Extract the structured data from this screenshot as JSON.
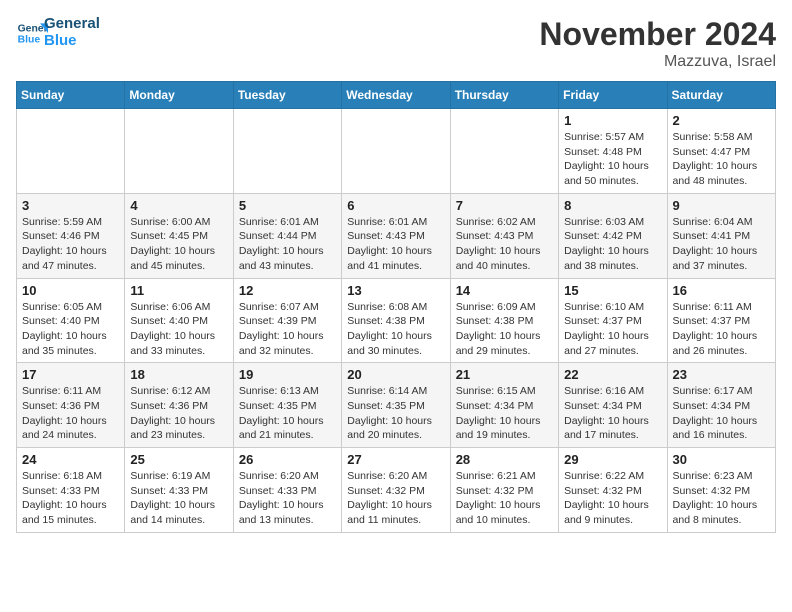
{
  "logo": {
    "line1": "General",
    "line2": "Blue"
  },
  "title": "November 2024",
  "location": "Mazzuva, Israel",
  "weekdays": [
    "Sunday",
    "Monday",
    "Tuesday",
    "Wednesday",
    "Thursday",
    "Friday",
    "Saturday"
  ],
  "weeks": [
    [
      {
        "day": "",
        "info": ""
      },
      {
        "day": "",
        "info": ""
      },
      {
        "day": "",
        "info": ""
      },
      {
        "day": "",
        "info": ""
      },
      {
        "day": "",
        "info": ""
      },
      {
        "day": "1",
        "info": "Sunrise: 5:57 AM\nSunset: 4:48 PM\nDaylight: 10 hours\nand 50 minutes."
      },
      {
        "day": "2",
        "info": "Sunrise: 5:58 AM\nSunset: 4:47 PM\nDaylight: 10 hours\nand 48 minutes."
      }
    ],
    [
      {
        "day": "3",
        "info": "Sunrise: 5:59 AM\nSunset: 4:46 PM\nDaylight: 10 hours\nand 47 minutes."
      },
      {
        "day": "4",
        "info": "Sunrise: 6:00 AM\nSunset: 4:45 PM\nDaylight: 10 hours\nand 45 minutes."
      },
      {
        "day": "5",
        "info": "Sunrise: 6:01 AM\nSunset: 4:44 PM\nDaylight: 10 hours\nand 43 minutes."
      },
      {
        "day": "6",
        "info": "Sunrise: 6:01 AM\nSunset: 4:43 PM\nDaylight: 10 hours\nand 41 minutes."
      },
      {
        "day": "7",
        "info": "Sunrise: 6:02 AM\nSunset: 4:43 PM\nDaylight: 10 hours\nand 40 minutes."
      },
      {
        "day": "8",
        "info": "Sunrise: 6:03 AM\nSunset: 4:42 PM\nDaylight: 10 hours\nand 38 minutes."
      },
      {
        "day": "9",
        "info": "Sunrise: 6:04 AM\nSunset: 4:41 PM\nDaylight: 10 hours\nand 37 minutes."
      }
    ],
    [
      {
        "day": "10",
        "info": "Sunrise: 6:05 AM\nSunset: 4:40 PM\nDaylight: 10 hours\nand 35 minutes."
      },
      {
        "day": "11",
        "info": "Sunrise: 6:06 AM\nSunset: 4:40 PM\nDaylight: 10 hours\nand 33 minutes."
      },
      {
        "day": "12",
        "info": "Sunrise: 6:07 AM\nSunset: 4:39 PM\nDaylight: 10 hours\nand 32 minutes."
      },
      {
        "day": "13",
        "info": "Sunrise: 6:08 AM\nSunset: 4:38 PM\nDaylight: 10 hours\nand 30 minutes."
      },
      {
        "day": "14",
        "info": "Sunrise: 6:09 AM\nSunset: 4:38 PM\nDaylight: 10 hours\nand 29 minutes."
      },
      {
        "day": "15",
        "info": "Sunrise: 6:10 AM\nSunset: 4:37 PM\nDaylight: 10 hours\nand 27 minutes."
      },
      {
        "day": "16",
        "info": "Sunrise: 6:11 AM\nSunset: 4:37 PM\nDaylight: 10 hours\nand 26 minutes."
      }
    ],
    [
      {
        "day": "17",
        "info": "Sunrise: 6:11 AM\nSunset: 4:36 PM\nDaylight: 10 hours\nand 24 minutes."
      },
      {
        "day": "18",
        "info": "Sunrise: 6:12 AM\nSunset: 4:36 PM\nDaylight: 10 hours\nand 23 minutes."
      },
      {
        "day": "19",
        "info": "Sunrise: 6:13 AM\nSunset: 4:35 PM\nDaylight: 10 hours\nand 21 minutes."
      },
      {
        "day": "20",
        "info": "Sunrise: 6:14 AM\nSunset: 4:35 PM\nDaylight: 10 hours\nand 20 minutes."
      },
      {
        "day": "21",
        "info": "Sunrise: 6:15 AM\nSunset: 4:34 PM\nDaylight: 10 hours\nand 19 minutes."
      },
      {
        "day": "22",
        "info": "Sunrise: 6:16 AM\nSunset: 4:34 PM\nDaylight: 10 hours\nand 17 minutes."
      },
      {
        "day": "23",
        "info": "Sunrise: 6:17 AM\nSunset: 4:34 PM\nDaylight: 10 hours\nand 16 minutes."
      }
    ],
    [
      {
        "day": "24",
        "info": "Sunrise: 6:18 AM\nSunset: 4:33 PM\nDaylight: 10 hours\nand 15 minutes."
      },
      {
        "day": "25",
        "info": "Sunrise: 6:19 AM\nSunset: 4:33 PM\nDaylight: 10 hours\nand 14 minutes."
      },
      {
        "day": "26",
        "info": "Sunrise: 6:20 AM\nSunset: 4:33 PM\nDaylight: 10 hours\nand 13 minutes."
      },
      {
        "day": "27",
        "info": "Sunrise: 6:20 AM\nSunset: 4:32 PM\nDaylight: 10 hours\nand 11 minutes."
      },
      {
        "day": "28",
        "info": "Sunrise: 6:21 AM\nSunset: 4:32 PM\nDaylight: 10 hours\nand 10 minutes."
      },
      {
        "day": "29",
        "info": "Sunrise: 6:22 AM\nSunset: 4:32 PM\nDaylight: 10 hours\nand 9 minutes."
      },
      {
        "day": "30",
        "info": "Sunrise: 6:23 AM\nSunset: 4:32 PM\nDaylight: 10 hours\nand 8 minutes."
      }
    ]
  ]
}
